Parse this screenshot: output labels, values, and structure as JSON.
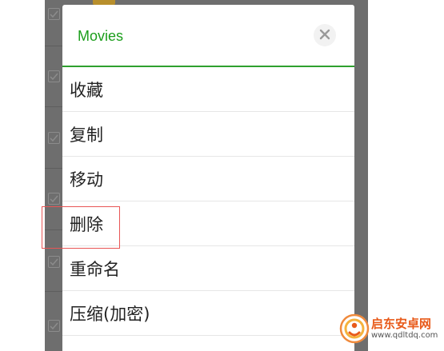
{
  "dialog": {
    "title": "Movies",
    "close_icon": "close-icon",
    "menu_items": [
      {
        "label": "收藏"
      },
      {
        "label": "复制"
      },
      {
        "label": "移动"
      },
      {
        "label": "删除"
      },
      {
        "label": "重命名"
      },
      {
        "label": "压缩(加密)"
      }
    ]
  },
  "highlighted_item": "删除",
  "watermark": {
    "name": "启东安卓网",
    "url": "www.qdltdq.com"
  },
  "colors": {
    "accent": "#1b9e1b",
    "divider": "#2ea02e",
    "overlay": "#6e6e6e",
    "highlight": "#e85555",
    "watermark": "#e85a1a"
  }
}
